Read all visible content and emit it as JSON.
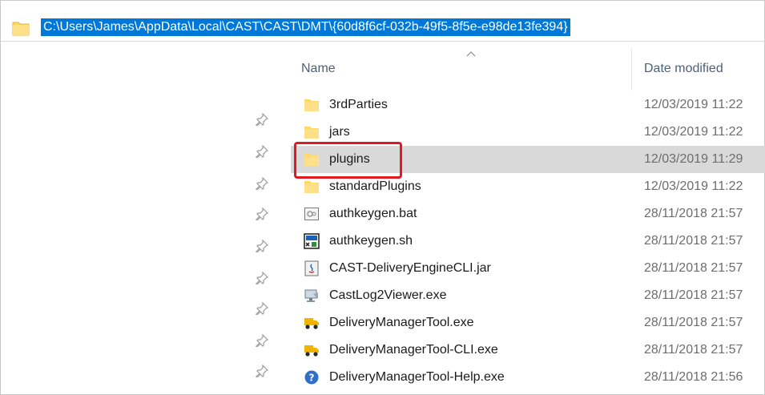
{
  "address_bar": {
    "path": "C:\\Users\\James\\AppData\\Local\\CAST\\CAST\\DMT\\{60d8f6cf-032b-49f5-8f5e-e98de13fe394}"
  },
  "columns": {
    "name": "Name",
    "date_modified": "Date modified",
    "sort_indicator": "sort-ascending-icon"
  },
  "files": [
    {
      "name": "3rdParties",
      "date": "12/03/2019 11:22",
      "icon": "folder-icon",
      "selected": false
    },
    {
      "name": "jars",
      "date": "12/03/2019 11:22",
      "icon": "folder-icon",
      "selected": false
    },
    {
      "name": "plugins",
      "date": "12/03/2019 11:29",
      "icon": "folder-icon",
      "selected": true
    },
    {
      "name": "standardPlugins",
      "date": "12/03/2019 11:22",
      "icon": "folder-icon",
      "selected": false
    },
    {
      "name": "authkeygen.bat",
      "date": "28/11/2018 21:57",
      "icon": "batch-file-icon",
      "selected": false
    },
    {
      "name": "authkeygen.sh",
      "date": "28/11/2018 21:57",
      "icon": "shell-script-icon",
      "selected": false
    },
    {
      "name": "CAST-DeliveryEngineCLI.jar",
      "date": "28/11/2018 21:57",
      "icon": "java-jar-icon",
      "selected": false
    },
    {
      "name": "CastLog2Viewer.exe",
      "date": "28/11/2018 21:57",
      "icon": "log-viewer-app-icon",
      "selected": false
    },
    {
      "name": "DeliveryManagerTool.exe",
      "date": "28/11/2018 21:57",
      "icon": "delivery-truck-icon",
      "selected": false
    },
    {
      "name": "DeliveryManagerTool-CLI.exe",
      "date": "28/11/2018 21:57",
      "icon": "delivery-truck-icon",
      "selected": false
    },
    {
      "name": "DeliveryManagerTool-Help.exe",
      "date": "28/11/2018 21:56",
      "icon": "help-icon",
      "selected": false
    }
  ],
  "colors": {
    "address_highlight": "#0078d7",
    "selected_row": "#d9d9d9",
    "annotation_box": "#e01a22",
    "folder_yellow": "#ffd866"
  }
}
